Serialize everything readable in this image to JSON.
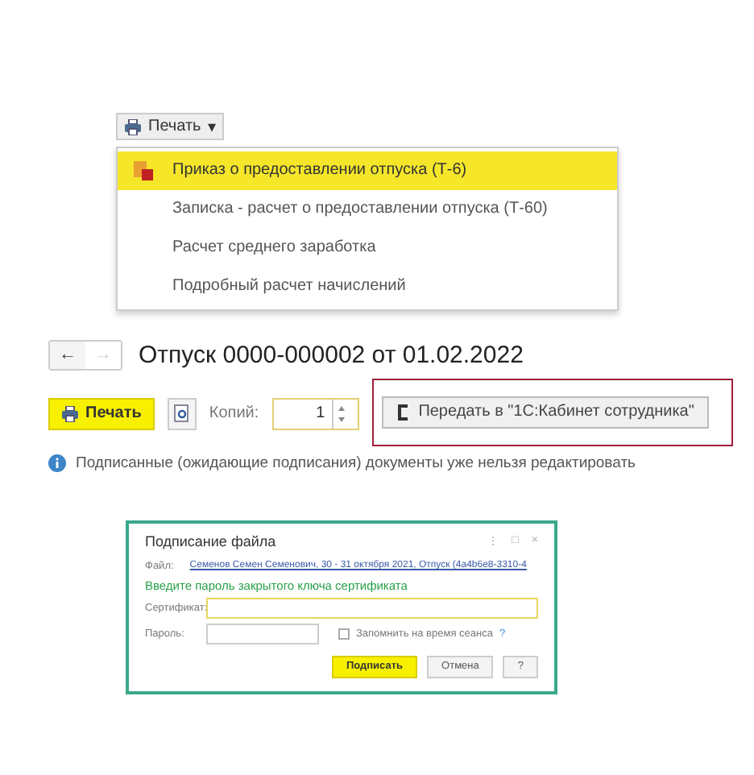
{
  "print_menu": {
    "button": {
      "label": "Печать",
      "caret": "▾"
    },
    "items": [
      {
        "label": "Приказ о предоставлении отпуска (Т-6)",
        "selected": true
      },
      {
        "label": "Записка - расчет о предоставлении отпуска (Т-60)",
        "selected": false
      },
      {
        "label": "Расчет среднего заработка",
        "selected": false
      },
      {
        "label": "Подробный расчет начислений",
        "selected": false
      }
    ]
  },
  "document": {
    "back": "←",
    "forward": "→",
    "title": "Отпуск 0000-000002 от 01.02.2022"
  },
  "toolbar": {
    "print": "Печать",
    "copies_label": "Копий:",
    "copies": "1",
    "send": "Передать в \"1С:Кабинет сотрудника\""
  },
  "info": "Подписанные (ожидающие подписания) документы уже нельзя редактировать",
  "dialog": {
    "title": "Подписание файла",
    "controls": [
      "⋮",
      "□",
      "×"
    ],
    "file_label": "Файл:",
    "file_link": "Семенов Семен Семенович, 30 - 31 октября 2021, Отпуск (4a4b6e8-3310-4",
    "hint": "Введите пароль закрытого ключа сертификата",
    "cert_label": "Сертификат:",
    "password_label": "Пароль:",
    "remember": {
      "label": "Запомнить на время сеанса",
      "checked": false
    },
    "help_mark": "?",
    "buttons": [
      {
        "label": "Подписать",
        "kind": "primary"
      },
      {
        "label": "Отмена",
        "kind": "normal"
      },
      {
        "label": "?",
        "kind": "normal"
      }
    ]
  }
}
